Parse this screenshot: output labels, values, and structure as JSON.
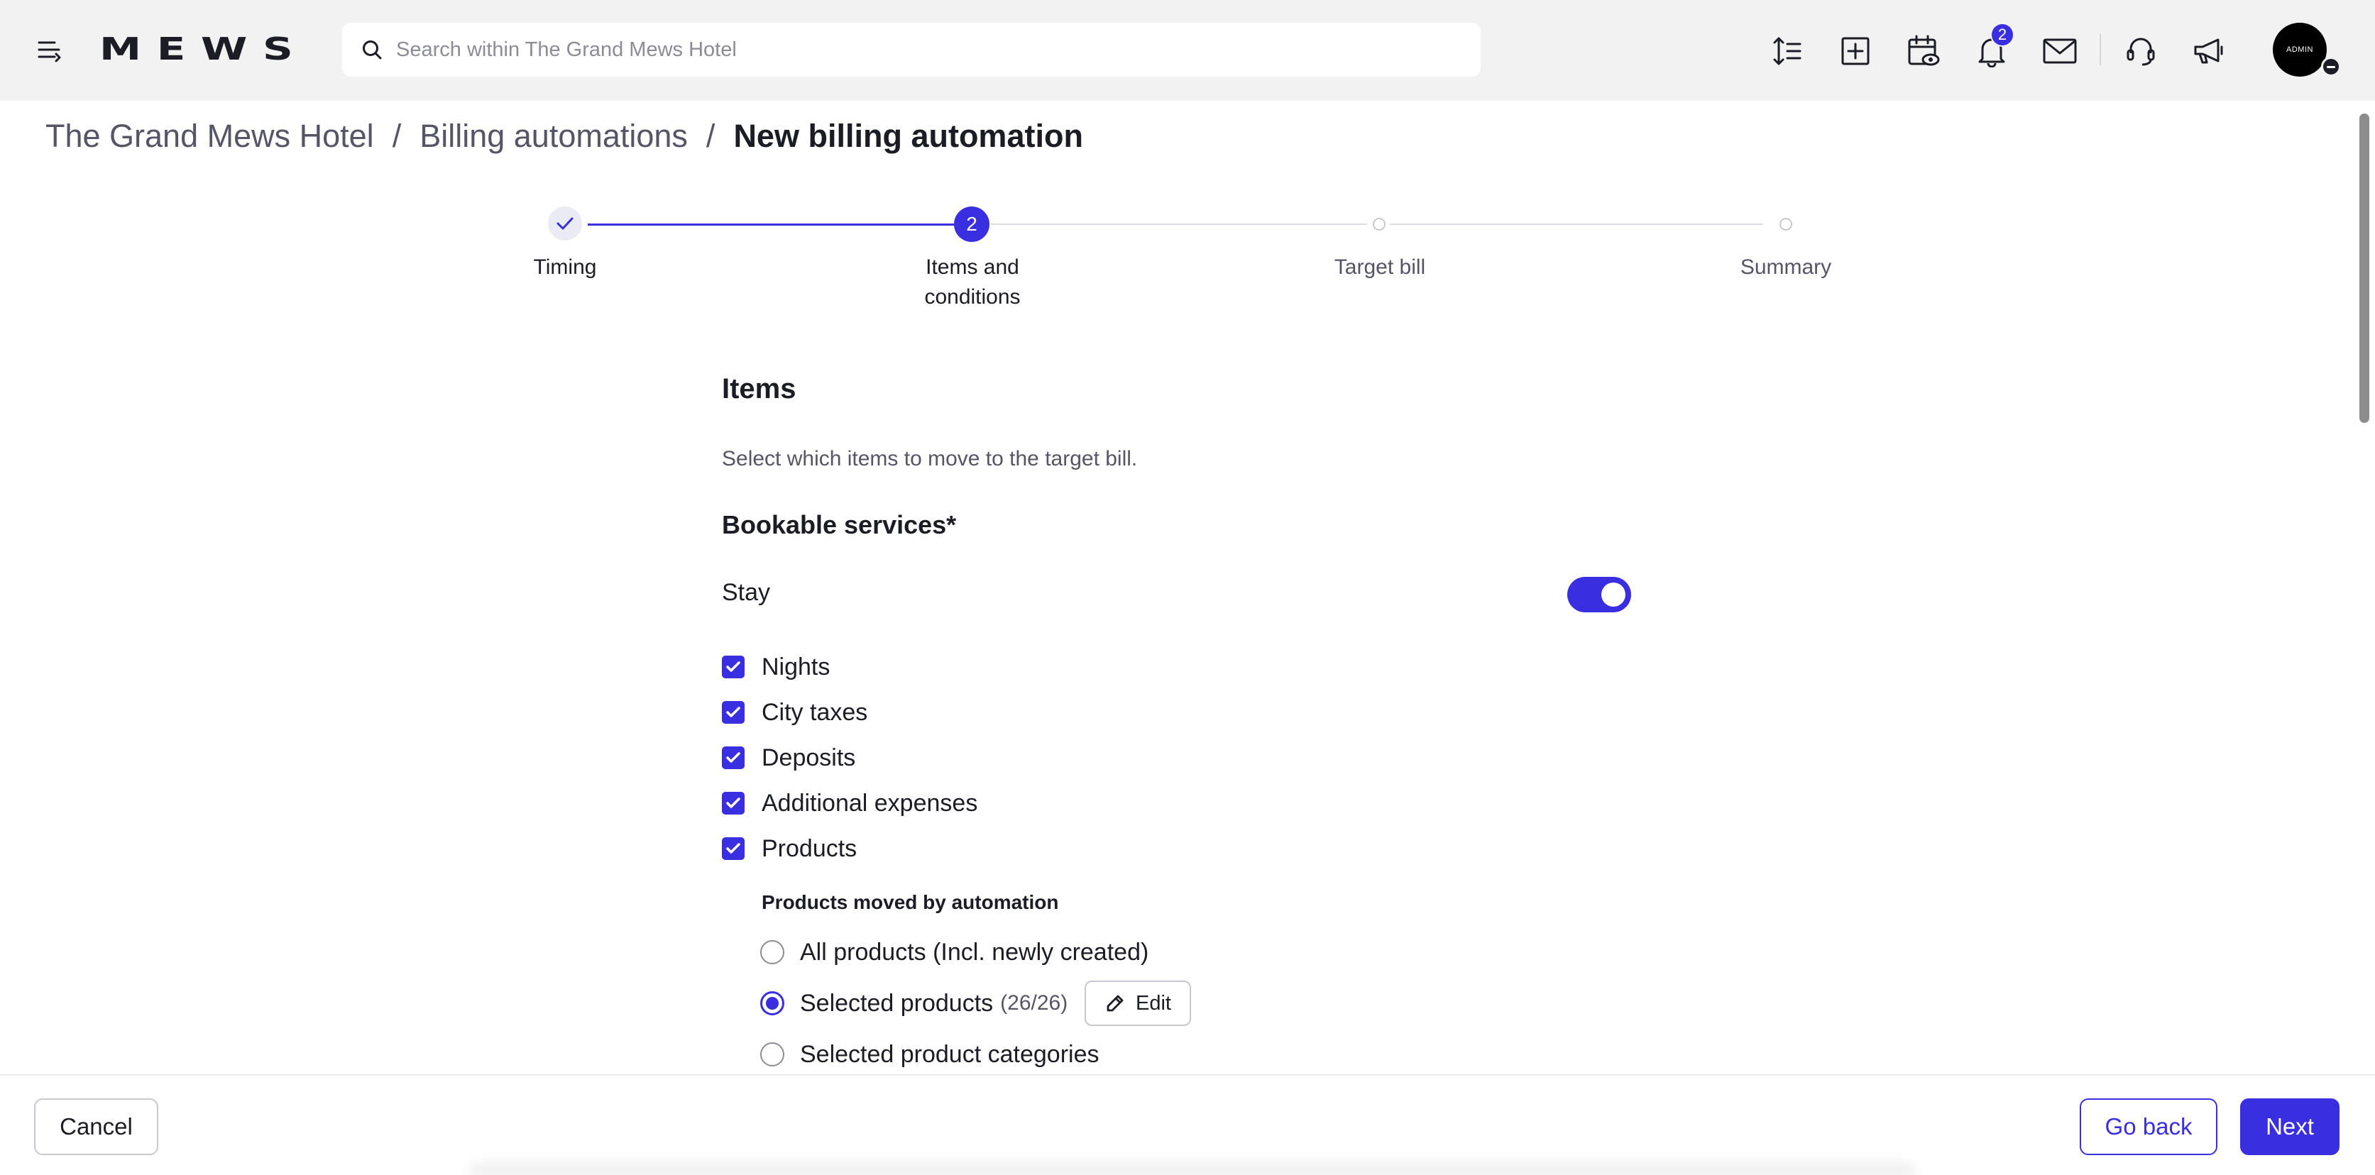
{
  "app": {
    "logo": "MEWS",
    "search_placeholder": "Search within The Grand Mews Hotel",
    "notifications_count": "2",
    "avatar_text": "ADMIN",
    "accent_color": "#3a2fe0"
  },
  "icons": {
    "menu": "menu-collapse-icon",
    "search": "search-icon",
    "sort": "sort-lines-icon",
    "add": "plus-square-icon",
    "calendar": "calendar-eye-icon",
    "bell": "bell-icon",
    "mail": "envelope-icon",
    "support": "headset-icon",
    "announce": "megaphone-icon",
    "edit": "pencil-icon",
    "check": "check-icon"
  },
  "breadcrumb": {
    "items": [
      "The Grand Mews Hotel",
      "Billing automations"
    ],
    "separator": "/",
    "current": "New billing automation"
  },
  "stepper": {
    "steps": [
      {
        "label": "Timing",
        "state": "done"
      },
      {
        "label": "Items and conditions",
        "label_line1": "Items and",
        "label_line2": "conditions",
        "number": "2",
        "state": "active"
      },
      {
        "label": "Target bill",
        "state": "upcoming"
      },
      {
        "label": "Summary",
        "state": "upcoming"
      }
    ]
  },
  "items": {
    "title": "Items",
    "description": "Select which items to move to the target bill.",
    "bookable_title": "Bookable services*",
    "stay_label": "Stay",
    "stay_enabled": true,
    "checkboxes": [
      {
        "label": "Nights",
        "checked": true
      },
      {
        "label": "City taxes",
        "checked": true
      },
      {
        "label": "Deposits",
        "checked": true
      },
      {
        "label": "Additional expenses",
        "checked": true
      },
      {
        "label": "Products",
        "checked": true
      }
    ],
    "products_moved_title": "Products moved by automation",
    "radios": [
      {
        "label": "All products (Incl. newly created)",
        "selected": false
      },
      {
        "label": "Selected products",
        "count": "(26/26)",
        "selected": true
      },
      {
        "label": "Selected product categories",
        "selected": false
      }
    ],
    "edit_label": "Edit"
  },
  "footer": {
    "cancel": "Cancel",
    "go_back": "Go back",
    "next": "Next"
  }
}
